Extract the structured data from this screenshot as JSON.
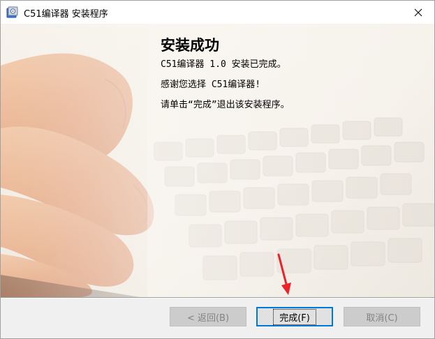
{
  "window": {
    "title": "C51编译器 安装程序"
  },
  "content": {
    "heading": "安装成功",
    "line1": "C51编译器 1.0 安装已完成。",
    "line2": "感谢您选择 C51编译器!",
    "line3": "请单击“完成”退出该安装程序。"
  },
  "buttons": {
    "back": "< 返回(B)",
    "finish": "完成(F)",
    "cancel": "取消(C)"
  },
  "colors": {
    "accent": "#0078d7",
    "annotation": "#e8242a"
  },
  "icons": {
    "title": "installer-icon",
    "close": "close-icon",
    "annotation": "red-arrow-icon"
  }
}
